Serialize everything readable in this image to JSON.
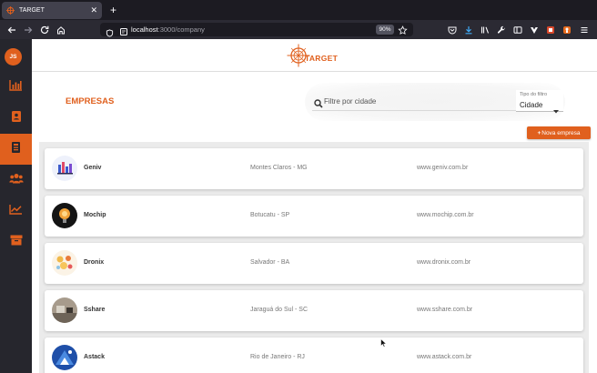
{
  "browser": {
    "tab_title": "TARGET",
    "url_host": "localhost",
    "url_path": ":3000/company",
    "zoom": "90%"
  },
  "sidebar": {
    "avatar_initials": "JS",
    "items": [
      {
        "icon": "bar-chart-icon",
        "active": false
      },
      {
        "icon": "contact-book-icon",
        "active": false
      },
      {
        "icon": "building-icon",
        "active": true
      },
      {
        "icon": "users-icon",
        "active": false
      },
      {
        "icon": "line-chart-icon",
        "active": false
      },
      {
        "icon": "archive-icon",
        "active": false
      }
    ]
  },
  "header": {
    "logo_text": "TARGET"
  },
  "page": {
    "title": "EMPRESAS",
    "filter_placeholder": "Filtre por cidade",
    "filter_type_caption": "Tipo do filtro",
    "filter_type_value": "Cidade",
    "new_button_label": "Nova empresa"
  },
  "companies": [
    {
      "name": "Geniv",
      "city": "Montes Claros - MG",
      "site": "www.geniv.com.br"
    },
    {
      "name": "Mochip",
      "city": "Botucatu - SP",
      "site": "www.mochip.com.br"
    },
    {
      "name": "Dronix",
      "city": "Salvador - BA",
      "site": "www.dronix.com.br"
    },
    {
      "name": "Sshare",
      "city": "Jaraguá do Sul - SC",
      "site": "www.sshare.com.br"
    },
    {
      "name": "Astack",
      "city": "Rio de Janeiro - RJ",
      "site": "www.astack.com.br"
    }
  ],
  "colors": {
    "accent": "#e0601e",
    "sidebar_bg": "#26262d",
    "list_bg": "#ebebeb"
  }
}
